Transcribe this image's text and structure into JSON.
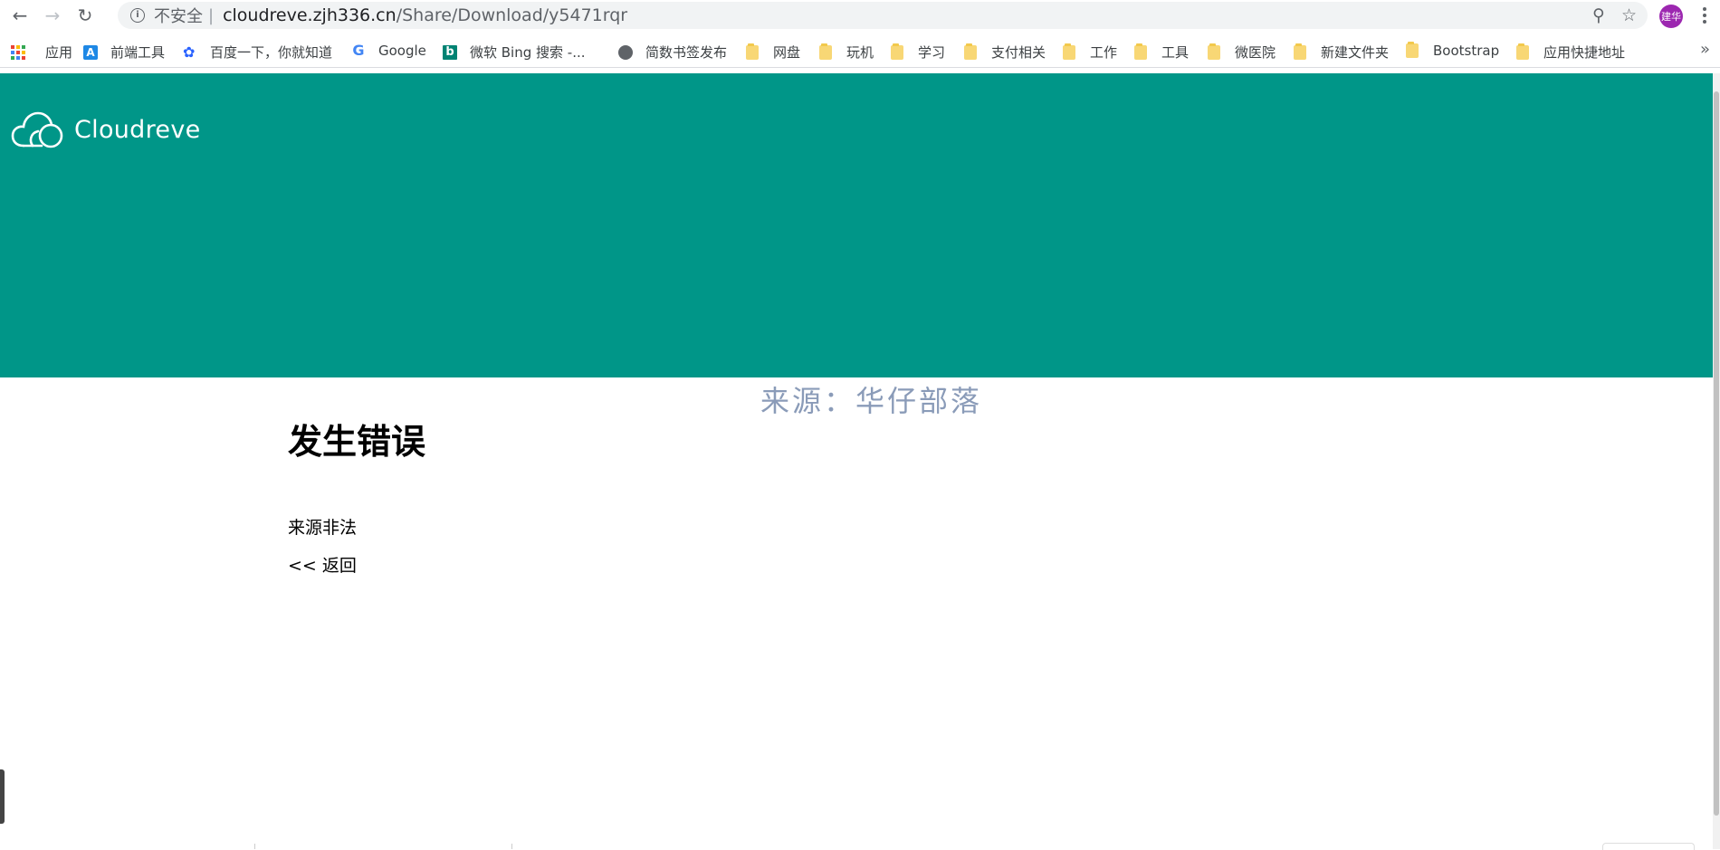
{
  "browser": {
    "security_label": "不安全",
    "separator": "|",
    "url_host": "cloudreve.zjh336.cn",
    "url_path": "/Share/Download/y5471rqr",
    "profile_initials": "建华"
  },
  "bookmarks": [
    {
      "label": "应用",
      "icon": "apps-grid-icon"
    },
    {
      "label": "前端工具",
      "icon": "a-icon"
    },
    {
      "label": "百度一下，你就知道",
      "icon": "baidu-paw-icon"
    },
    {
      "label": "Google",
      "icon": "google-icon"
    },
    {
      "label": "微软 Bing 搜索 -...",
      "icon": "bing-icon"
    },
    {
      "label": "简数书签发布",
      "icon": "globe-icon"
    },
    {
      "label": "网盘",
      "icon": "folder-icon"
    },
    {
      "label": "玩机",
      "icon": "folder-icon"
    },
    {
      "label": "学习",
      "icon": "folder-icon"
    },
    {
      "label": "支付相关",
      "icon": "folder-icon"
    },
    {
      "label": "工作",
      "icon": "folder-icon"
    },
    {
      "label": "工具",
      "icon": "folder-icon"
    },
    {
      "label": "微医院",
      "icon": "folder-icon"
    },
    {
      "label": "新建文件夹",
      "icon": "folder-icon"
    },
    {
      "label": "Bootstrap",
      "icon": "folder-icon"
    },
    {
      "label": "应用快捷地址",
      "icon": "folder-icon"
    }
  ],
  "page": {
    "brand_name": "Cloudreve",
    "banner_color": "#009688",
    "watermark": "来源：华仔部落",
    "error_title": "发生错误",
    "error_message": "来源非法",
    "back_link": "<< 返回"
  },
  "colors": {
    "accent": "#009688",
    "avatar": "#9c27b0",
    "folder": "#f8d775"
  }
}
